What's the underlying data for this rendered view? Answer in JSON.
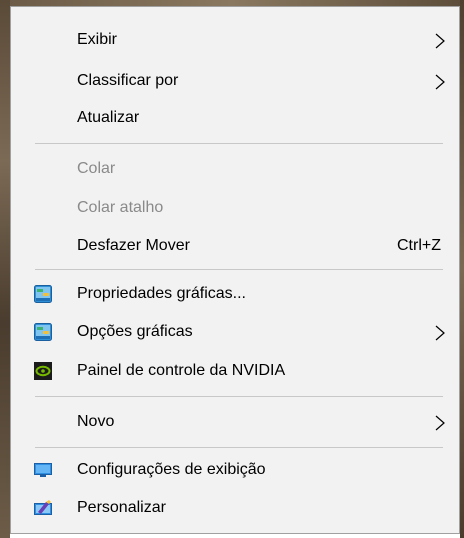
{
  "menu": {
    "items": [
      {
        "label": "Exibir",
        "submenu": true,
        "enabled": true
      },
      {
        "label": "Classificar por",
        "submenu": true,
        "enabled": true
      },
      {
        "label": "Atualizar",
        "submenu": false,
        "enabled": true
      },
      {
        "label": "Colar",
        "submenu": false,
        "enabled": false
      },
      {
        "label": "Colar atalho",
        "submenu": false,
        "enabled": false
      },
      {
        "label": "Desfazer Mover",
        "shortcut": "Ctrl+Z",
        "submenu": false,
        "enabled": true
      },
      {
        "label": "Propriedades gráficas...",
        "icon": "intel-graphics-icon",
        "submenu": false,
        "enabled": true
      },
      {
        "label": "Opções gráficas",
        "icon": "intel-graphics-icon",
        "submenu": true,
        "enabled": true
      },
      {
        "label": "Painel de controle da NVIDIA",
        "icon": "nvidia-icon",
        "submenu": false,
        "enabled": true
      },
      {
        "label": "Novo",
        "submenu": true,
        "enabled": true
      },
      {
        "label": "Configurações de exibição",
        "icon": "display-icon",
        "submenu": false,
        "enabled": true
      },
      {
        "label": "Personalizar",
        "icon": "personalize-icon",
        "submenu": false,
        "enabled": true
      }
    ]
  },
  "colors": {
    "menu_background": "#f2f2f2",
    "disabled_text": "#8a8a8a",
    "separator": "#c8c8c8"
  }
}
